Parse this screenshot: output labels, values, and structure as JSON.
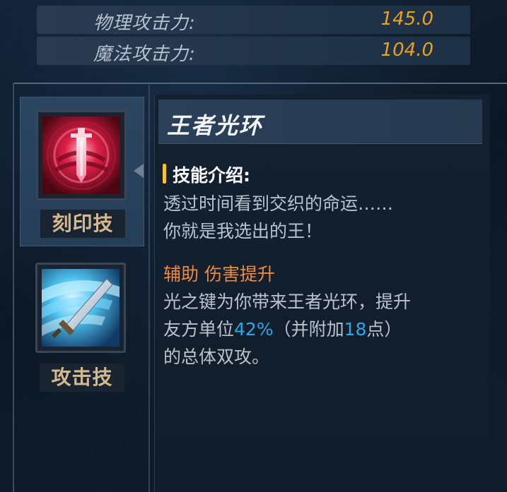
{
  "stats": [
    {
      "label": "物理攻击力:",
      "value": "145.0"
    },
    {
      "label": "魔法攻击力:",
      "value": "104.0"
    }
  ],
  "tabs": [
    {
      "label": "刻印技",
      "icon": "crimson-sword-emblem-icon",
      "active": true
    },
    {
      "label": "攻击技",
      "icon": "ice-slash-sword-icon",
      "active": false
    }
  ],
  "skill": {
    "title": "王者光环",
    "section_heading": "技能介绍:",
    "intro_lines": [
      "透过时间看到交织的命运……",
      "你就是我选出的王！"
    ],
    "buff_heading": "辅助 伤害提升",
    "desc_line1": "光之键为你带来王者光环，提升",
    "desc_line2_a": "友方单位",
    "desc_line2_percent": "42%",
    "desc_line2_b": "（并附加",
    "desc_line2_points": "18",
    "desc_line2_c": "点）",
    "desc_line3": "的总体双攻。"
  },
  "colors": {
    "value": "#e7a21f",
    "tab_label": "#d2b98f",
    "buff_heading": "#ef8a3e",
    "highlight": "#29a7e6",
    "section_marker": "#f2c531"
  }
}
